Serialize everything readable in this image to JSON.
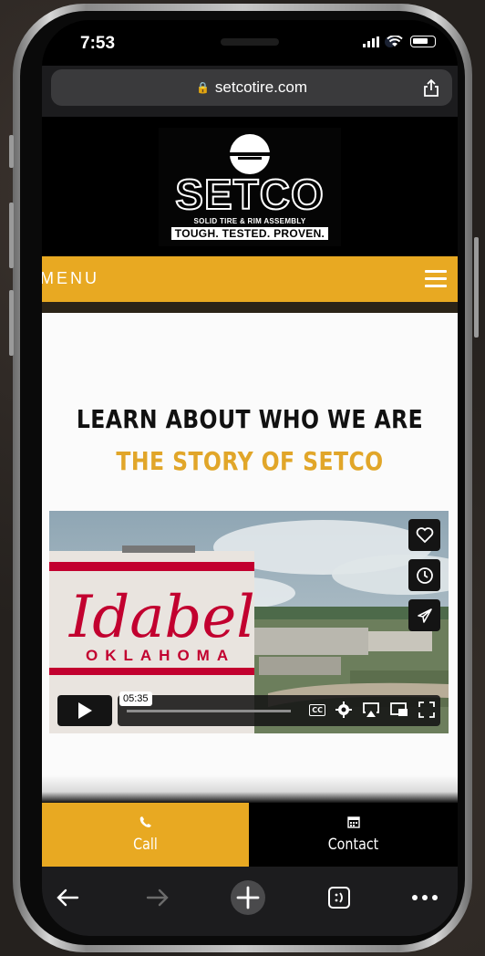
{
  "status": {
    "time": "7:53"
  },
  "browser": {
    "url": "setcotire.com"
  },
  "logo": {
    "name": "SETCO",
    "subtitle": "SOLID TIRE & RIM ASSEMBLY",
    "tagline": "TOUGH. TESTED. PROVEN."
  },
  "nav": {
    "menu_label": "MENU"
  },
  "section": {
    "heading": "LEARN ABOUT WHO WE ARE",
    "subheading": "THE STORY OF SETCO"
  },
  "video": {
    "tower_text_1": "Idabel",
    "tower_text_2": "OKLAHOMA",
    "timestamp": "05:35"
  },
  "footer": {
    "call_label": "Call",
    "contact_label": "Contact"
  },
  "colors": {
    "accent": "#e8a922",
    "heading": "#111111",
    "subheading": "#e1a629"
  }
}
